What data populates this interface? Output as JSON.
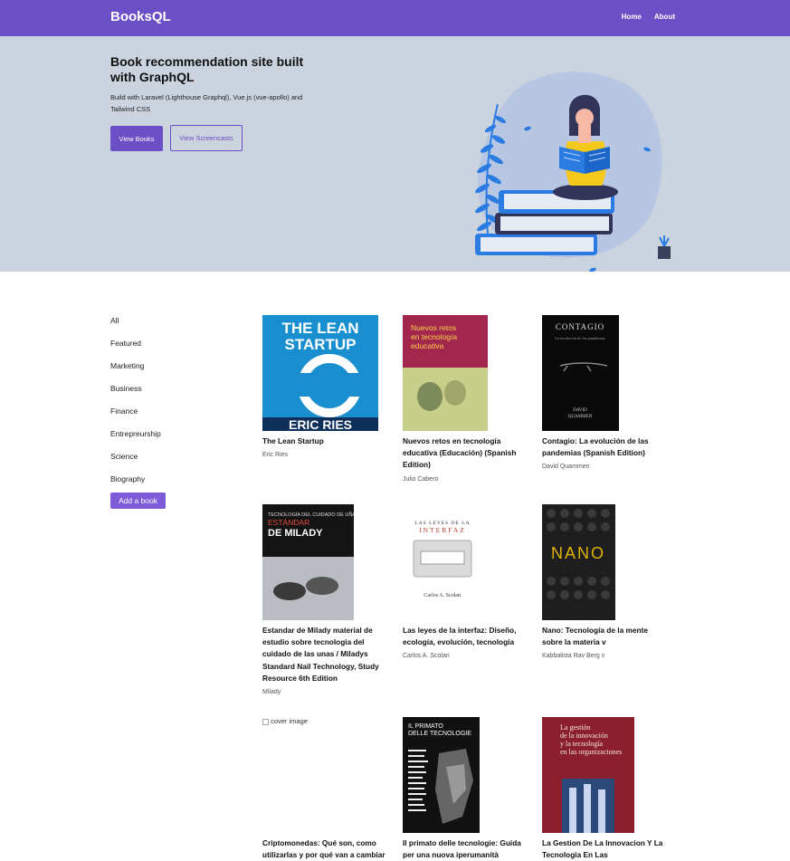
{
  "nav": {
    "brand": "BooksQL",
    "links": [
      "Home",
      "About"
    ]
  },
  "hero": {
    "title": "Book recommendation site built with GraphQL",
    "subtitle": "Build with Laravel (Lighthouse Graphql), Vue.js (vue-apollo) and Tailwind CSS",
    "primary_button": "View Books",
    "secondary_button": "View Screencasts"
  },
  "sidebar": {
    "categories": [
      "All",
      "Featured",
      "Marketing",
      "Business",
      "Finance",
      "Entrepreurship",
      "Science",
      "Biography"
    ],
    "add_button": "Add a book"
  },
  "books": [
    {
      "title": "The Lean Startup",
      "author": "Eric Ries",
      "cover_title": "THE LEAN STARTUP",
      "cover_author": "ERIC RIES",
      "cover_color": "#1a8fd0"
    },
    {
      "title": "Nuevos retos en tecnología educativa (Educación) (Spanish Edition)",
      "author": "Julio Cabero",
      "cover_title": "Nuevos retos en tecnología educativa",
      "cover_color": "#a3264d"
    },
    {
      "title": "Contagio: La evolución de las pandemias (Spanish Edition)",
      "author": "David Quammen",
      "cover_title": "CONTAGIO",
      "cover_subtitle": "La evolución de las pandemias",
      "cover_author": "DAVID QUAMMEN",
      "cover_color": "#0a0a0a"
    },
    {
      "title": "Estandar de Milady material de estudio sobre tecnologia del cuidado de las unas / Miladys Standard Nail Technology, Study Resource 6th Edition",
      "author": "Milady",
      "cover_title": "ESTÁNDAR DE MILADY",
      "cover_subtitle": "TECNOLOGÍA DEL CUIDADO DE UÑAS",
      "cover_color": "#141414"
    },
    {
      "title": "Las leyes de la interfaz: Diseño, ecología, evolución, tecnología",
      "author": "Carlos A. Scolari",
      "cover_title": "LAS LEYES DE LA INTERFAZ",
      "cover_author": "Carlos A. Scolari",
      "cover_color": "#ffffff"
    },
    {
      "title": "Nano: Tecnología de la mente sobre la materia v",
      "author": "Kabbalista Rav Berg v",
      "cover_title": "NANO",
      "cover_color": "#1e1e1e"
    },
    {
      "title": "Criptomonedas: Qué son, como utilizarlas y por qué van a cambiar",
      "author": "",
      "cover_alt": "cover image",
      "cover_color": ""
    },
    {
      "title": "Il primato delle tecnologie: Guida per una nuova iperumanità",
      "author": "",
      "cover_title": "IL PRIMATO DELLE TECNOLOGIE",
      "cover_color": "#111111"
    },
    {
      "title": "La Gestion De La Innovacion Y La Tecnologia En Las",
      "author": "",
      "cover_title": "La gestión de la innovación y la tecnología en las organizaciones",
      "cover_color": "#8b1f2b"
    }
  ]
}
